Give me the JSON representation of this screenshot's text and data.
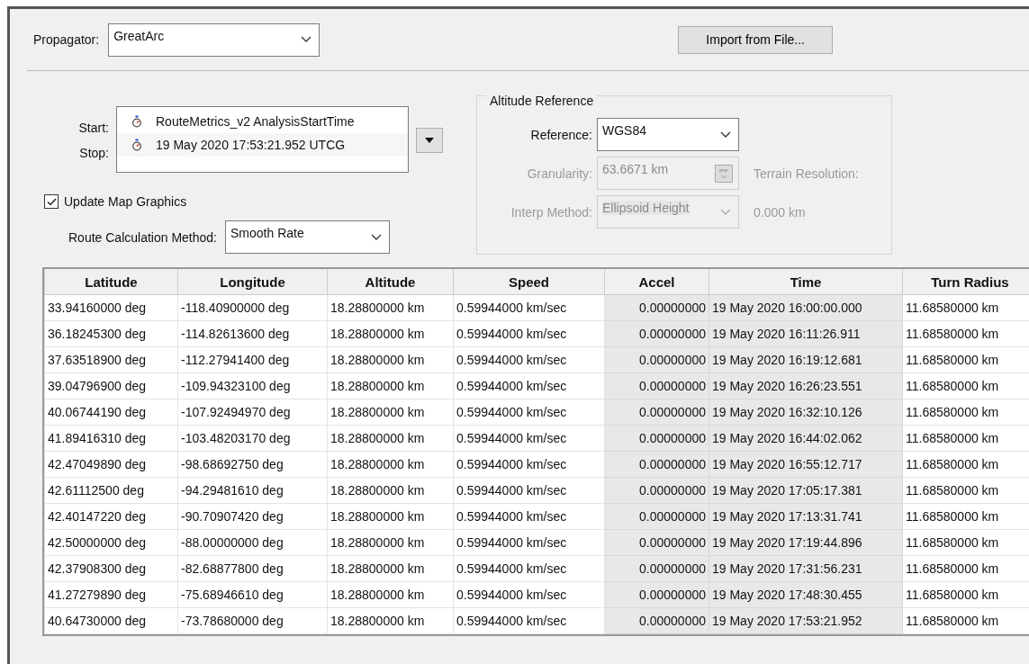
{
  "propagator": {
    "label": "Propagator:",
    "value": "GreatArc"
  },
  "import_button": "Import from File...",
  "interval": {
    "items": [
      {
        "label": "Start:",
        "value": "RouteMetrics_v2 AnalysisStartTime"
      },
      {
        "label": "Stop:",
        "value": "19 May 2020 17:53:21.952 UTCG"
      }
    ]
  },
  "update_map_graphics": {
    "label": "Update Map Graphics",
    "checked": true
  },
  "route_method": {
    "label": "Route Calculation Method:",
    "value": "Smooth Rate"
  },
  "altitude_reference": {
    "title": "Altitude Reference",
    "reference": {
      "label": "Reference:",
      "value": "WGS84",
      "disabled": false
    },
    "granularity": {
      "label": "Granularity:",
      "value": "63.6671 km",
      "disabled": true
    },
    "terrain_resolution": {
      "label": "Terrain Resolution:",
      "value": "0.000 km",
      "disabled": true
    },
    "interp_method": {
      "label": "Interp Method:",
      "value": "Ellipsoid Height",
      "disabled": true
    }
  },
  "table": {
    "columns": [
      {
        "label": "Latitude",
        "readonly": false
      },
      {
        "label": "Longitude",
        "readonly": false
      },
      {
        "label": "Altitude",
        "readonly": false
      },
      {
        "label": "Speed",
        "readonly": false
      },
      {
        "label": "Accel",
        "readonly": true
      },
      {
        "label": "Time",
        "readonly": true
      },
      {
        "label": "Turn Radius",
        "readonly": false
      }
    ],
    "rows": [
      [
        "33.94160000 deg",
        "-118.40900000 deg",
        "18.28800000 km",
        "0.59944000 km/sec",
        "0.00000000",
        "19 May 2020 16:00:00.000",
        "11.68580000 km"
      ],
      [
        "36.18245300 deg",
        "-114.82613600 deg",
        "18.28800000 km",
        "0.59944000 km/sec",
        "0.00000000",
        "19 May 2020 16:11:26.911",
        "11.68580000 km"
      ],
      [
        "37.63518900 deg",
        "-112.27941400 deg",
        "18.28800000 km",
        "0.59944000 km/sec",
        "0.00000000",
        "19 May 2020 16:19:12.681",
        "11.68580000 km"
      ],
      [
        "39.04796900 deg",
        "-109.94323100 deg",
        "18.28800000 km",
        "0.59944000 km/sec",
        "0.00000000",
        "19 May 2020 16:26:23.551",
        "11.68580000 km"
      ],
      [
        "40.06744190 deg",
        "-107.92494970 deg",
        "18.28800000 km",
        "0.59944000 km/sec",
        "0.00000000",
        "19 May 2020 16:32:10.126",
        "11.68580000 km"
      ],
      [
        "41.89416310 deg",
        "-103.48203170 deg",
        "18.28800000 km",
        "0.59944000 km/sec",
        "0.00000000",
        "19 May 2020 16:44:02.062",
        "11.68580000 km"
      ],
      [
        "42.47049890 deg",
        "-98.68692750 deg",
        "18.28800000 km",
        "0.59944000 km/sec",
        "0.00000000",
        "19 May 2020 16:55:12.717",
        "11.68580000 km"
      ],
      [
        "42.61112500 deg",
        "-94.29481610 deg",
        "18.28800000 km",
        "0.59944000 km/sec",
        "0.00000000",
        "19 May 2020 17:05:17.381",
        "11.68580000 km"
      ],
      [
        "42.40147220 deg",
        "-90.70907420 deg",
        "18.28800000 km",
        "0.59944000 km/sec",
        "0.00000000",
        "19 May 2020 17:13:31.741",
        "11.68580000 km"
      ],
      [
        "42.50000000 deg",
        "-88.00000000 deg",
        "18.28800000 km",
        "0.59944000 km/sec",
        "0.00000000",
        "19 May 2020 17:19:44.896",
        "11.68580000 km"
      ],
      [
        "42.37908300 deg",
        "-82.68877800 deg",
        "18.28800000 km",
        "0.59944000 km/sec",
        "0.00000000",
        "19 May 2020 17:31:56.231",
        "11.68580000 km"
      ],
      [
        "41.27279890 deg",
        "-75.68946610 deg",
        "18.28800000 km",
        "0.59944000 km/sec",
        "0.00000000",
        "19 May 2020 17:48:30.455",
        "11.68580000 km"
      ],
      [
        "40.64730000 deg",
        "-73.78680000 deg",
        "18.28800000 km",
        "0.59944000 km/sec",
        "0.00000000",
        "19 May 2020 17:53:21.952",
        "11.68580000 km"
      ]
    ]
  }
}
